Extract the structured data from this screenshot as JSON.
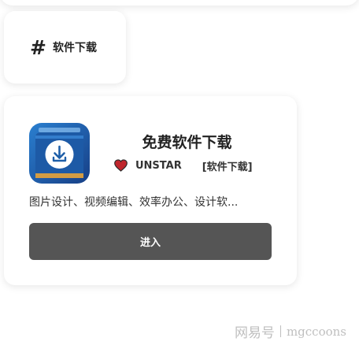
{
  "tag": {
    "hash": "#",
    "label": "软件下载"
  },
  "app": {
    "icon": "download-folder-icon",
    "title": "免费软件下载",
    "author": "UNSTAR",
    "category": "[软件下载]",
    "description": "图片设计、视频编辑、效率办公、设计软...",
    "enter_label": "进入"
  },
  "watermark": {
    "brand": "网易号",
    "user": "mgccoons"
  },
  "colors": {
    "button": "#555555",
    "heart": "#c0262d",
    "icon_blue": "#1f5fa8"
  }
}
